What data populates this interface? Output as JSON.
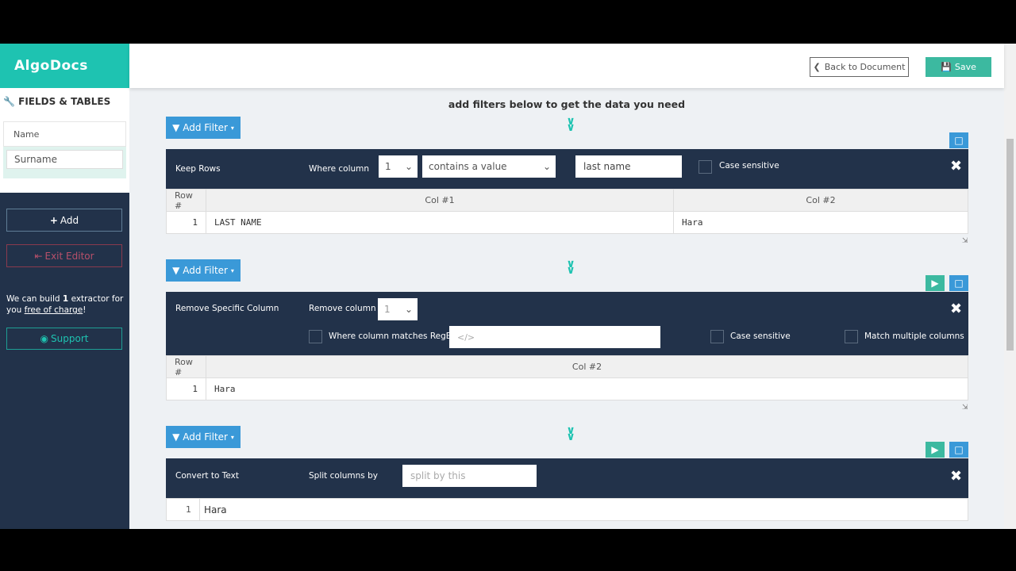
{
  "app": {
    "logo": "AlgoDocs"
  },
  "header": {
    "back_label": "Back to Document",
    "save_label": "Save"
  },
  "sidebar": {
    "section_title": "FIELDS & TABLES",
    "fields": [
      {
        "label": "Name"
      },
      {
        "label": "Surname"
      }
    ],
    "add_label": "Add",
    "exit_label": "Exit Editor",
    "promo_pre": "We can build ",
    "promo_count": "1",
    "promo_mid": " extractor for you ",
    "promo_link": "free of charge",
    "promo_end": "!",
    "support_label": "Support"
  },
  "main": {
    "heading": "add filters below to get the data you need",
    "add_filter_label": "Add Filter",
    "filters": [
      {
        "name": "Keep Rows",
        "where_label": "Where column",
        "column": "1",
        "condition": "contains a value",
        "value": "last name",
        "case_label": "Case sensitive",
        "headers": [
          "Row #",
          "Col #1",
          "Col #2"
        ],
        "rows": [
          [
            "1",
            "LAST NAME",
            "Hara"
          ]
        ]
      },
      {
        "name": "Remove Specific Column",
        "remove_label": "Remove column #",
        "column": "1",
        "regex_label": "Where column matches RegEx",
        "regex_placeholder": "</>",
        "case_label": "Case sensitive",
        "multi_label": "Match multiple columns",
        "headers": [
          "Row #",
          "Col #2"
        ],
        "rows": [
          [
            "1",
            "Hara"
          ]
        ]
      },
      {
        "name": "Convert to Text",
        "split_label": "Split columns by",
        "split_placeholder": "split by this",
        "rows": [
          [
            "1",
            "Hara"
          ]
        ]
      }
    ]
  },
  "colors": {
    "teal": "#1ec3b1",
    "navy": "#22324a",
    "blue": "#3a99d8",
    "save": "#3cb9a0"
  }
}
